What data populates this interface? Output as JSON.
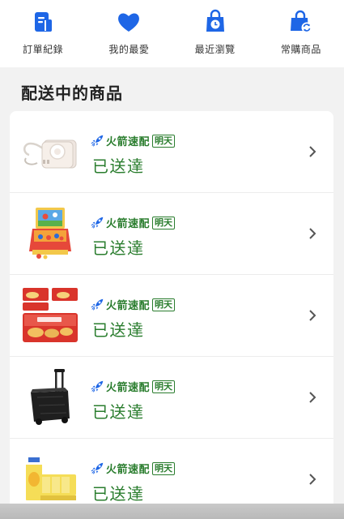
{
  "shortcuts": [
    {
      "label": "訂單紀錄",
      "icon": "receipt-icon"
    },
    {
      "label": "我的最愛",
      "icon": "heart-icon"
    },
    {
      "label": "最近瀏覽",
      "icon": "recent-bag-icon"
    },
    {
      "label": "常購商品",
      "icon": "repeat-bag-icon"
    }
  ],
  "section": {
    "title": "配送中的商品"
  },
  "colors": {
    "accent": "#1e66e6",
    "status_green": "#2a7d2e"
  },
  "items": [
    {
      "shipping": "火箭速配",
      "badge": "明天",
      "status": "已送達",
      "thumb": "power-bank-image"
    },
    {
      "shipping": "火箭速配",
      "badge": "明天",
      "status": "已送達",
      "thumb": "arcade-toy-image"
    },
    {
      "shipping": "火箭速配",
      "badge": "明天",
      "status": "已送達",
      "thumb": "cream-puff-snack-image"
    },
    {
      "shipping": "火箭速配",
      "badge": "明天",
      "status": "已送達",
      "thumb": "folding-cart-image"
    },
    {
      "shipping": "火箭速配",
      "badge": "明天",
      "status": "已送達",
      "thumb": "juice-box-image"
    }
  ]
}
